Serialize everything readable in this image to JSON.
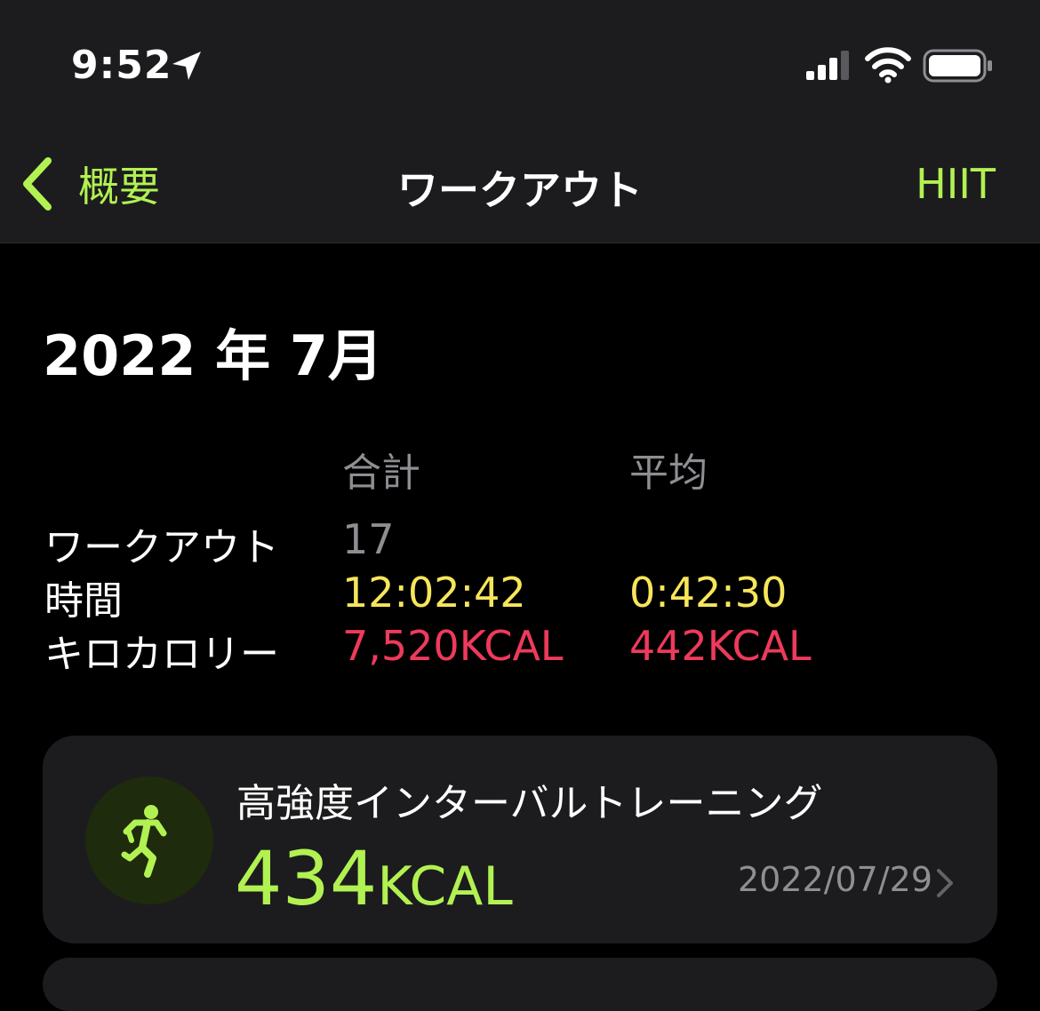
{
  "status_bar": {
    "time": "9:52"
  },
  "nav": {
    "back_label": "概要",
    "title": "ワークアウト",
    "right_label": "HIIT"
  },
  "summary": {
    "month": "2022 年 7月",
    "col_total": "合計",
    "col_average": "平均",
    "rows": [
      {
        "label": "ワークアウト",
        "total": "17",
        "average": ""
      },
      {
        "label": "時間",
        "total": "12:02:42",
        "average": "0:42:30"
      },
      {
        "label": "キロカロリー",
        "total": "7,520KCAL",
        "average": "442KCAL"
      }
    ]
  },
  "workouts": [
    {
      "name": "高強度インターバルトレーニング",
      "kcal_value": "434",
      "kcal_unit": "KCAL",
      "date": "2022/07/29"
    }
  ],
  "colors": {
    "accent_green": "#b2f152",
    "time_yellow": "#f7e55b",
    "kcal_red": "#ee3a5b",
    "secondary_gray": "#8e8e93",
    "card_bg": "#1c1c1e"
  },
  "icons": {
    "location": "location-arrow-icon",
    "signal": "cellular-signal-icon",
    "wifi": "wifi-icon",
    "battery": "battery-icon",
    "back": "chevron-left-icon",
    "activity": "runner-icon",
    "disclosure": "chevron-right-icon"
  }
}
